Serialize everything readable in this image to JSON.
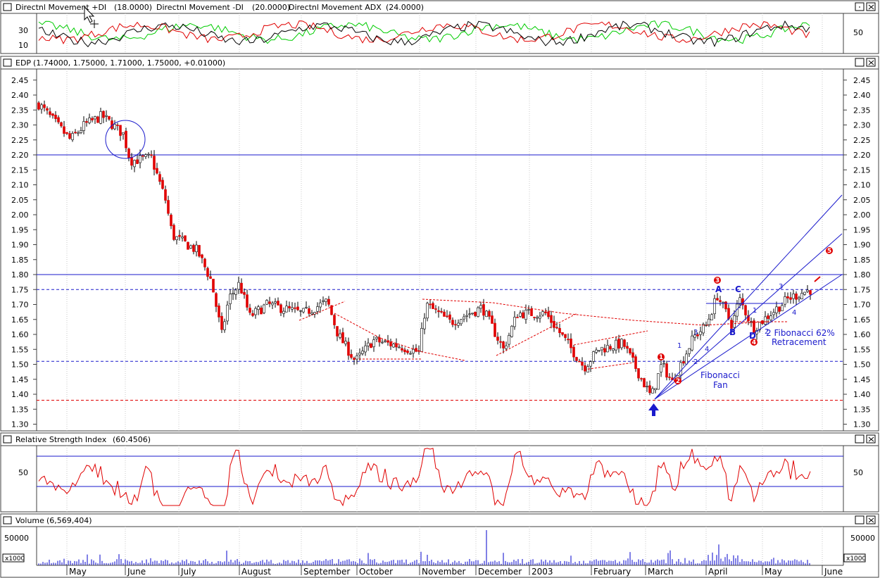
{
  "colors": {
    "background": "#ffffff",
    "frame": "#404040",
    "titlebar": "#ffffff",
    "grid": "#c8c8c8",
    "up_candle": "#ffffff",
    "down_candle": "#e00000",
    "positive_di": "#00cc00",
    "negative_di": "#e00000",
    "adx": "#000000",
    "rsi": "#e00000",
    "volume": "#0000cc",
    "annotation_blue": "#1a1acc",
    "annotation_red": "#e00000"
  },
  "panes": {
    "dmi": {
      "title_prefix": "Directnl Movement +DI",
      "plus_di_value": "(18.0000)",
      "minus_di_label": "Directnl Movement -DI",
      "minus_di_value": "(20.0000)",
      "adx_label": "Directnl Movement ADX",
      "adx_value": "(24.0000)",
      "left_ticks": [
        "30",
        "10"
      ],
      "right_ticks": [
        "50"
      ]
    },
    "price": {
      "title_symbol": "EDP",
      "title_values": "(1.74000, 1.75000, 1.71000, 1.75000, +0.01000)",
      "ticks": [
        "2.45",
        "2.40",
        "2.35",
        "2.30",
        "2.25",
        "2.20",
        "2.15",
        "2.10",
        "2.05",
        "2.00",
        "1.95",
        "1.90",
        "1.85",
        "1.80",
        "1.75",
        "1.70",
        "1.65",
        "1.60",
        "1.55",
        "1.50",
        "1.45",
        "1.40",
        "1.35",
        "1.30"
      ]
    },
    "rsi": {
      "title": "Relative Strength Index",
      "value": "(60.4506)",
      "left_ticks": [
        "50"
      ],
      "right_ticks": [
        "50"
      ]
    },
    "volume": {
      "title": "Volume",
      "value": "(6,569,404)",
      "tick_50000": "50000",
      "multiplier": "x1000"
    }
  },
  "x_axis": {
    "months": [
      "May",
      "June",
      "July",
      "August",
      "September",
      "October",
      "November",
      "December",
      "2003",
      "February",
      "March",
      "April",
      "May",
      "June"
    ]
  },
  "annotations": {
    "fib_fan": "Fibonacci\nFan",
    "fib_retr": "2 Fibonacci 62%\nRetracement",
    "wave_a": "A",
    "wave_b": "B",
    "wave_c": "C",
    "wave_d": "D",
    "impulse_labels": [
      "1",
      "2",
      "3",
      "4",
      "5"
    ],
    "sub_labels": [
      "1",
      "2",
      "3",
      "4",
      "1",
      "2",
      "3",
      "4"
    ]
  },
  "chart_data": [
    {
      "type": "line",
      "title": "Directnl Movement +DI / -DI / ADX",
      "series": [
        {
          "name": "Directnl Movement +DI",
          "last": 18.0
        },
        {
          "name": "Directnl Movement -DI",
          "last": 20.0
        },
        {
          "name": "Directnl Movement ADX",
          "last": 24.0
        }
      ]
    },
    {
      "type": "candlestick",
      "title": "EDP",
      "ohlc_last": {
        "open": 1.74,
        "high": 1.75,
        "low": 1.71,
        "close": 1.75,
        "change": 0.01
      },
      "ylim": [
        1.3,
        2.45
      ],
      "horizontal_levels": [
        2.2,
        1.8,
        1.75,
        1.51,
        1.38
      ],
      "approx_closes_by_month": [
        {
          "month": "May",
          "close": 2.3
        },
        {
          "month": "June",
          "close": 2.18
        },
        {
          "month": "July",
          "close": 1.88
        },
        {
          "month": "August",
          "close": 1.72
        },
        {
          "month": "September",
          "close": 1.65
        },
        {
          "month": "October",
          "close": 1.55
        },
        {
          "month": "November",
          "close": 1.63
        },
        {
          "month": "December",
          "close": 1.58
        },
        {
          "month": "2003",
          "close": 1.64
        },
        {
          "month": "February",
          "close": 1.52
        },
        {
          "month": "March",
          "close": 1.45
        },
        {
          "month": "April",
          "close": 1.7
        },
        {
          "month": "May",
          "close": 1.73
        }
      ]
    },
    {
      "type": "line",
      "title": "Relative Strength Index",
      "series": [
        {
          "name": "Relative Strength Index",
          "last": 60.4506
        }
      ]
    },
    {
      "type": "bar",
      "title": "Volume",
      "series": [
        {
          "name": "Volume",
          "last": 6569404
        }
      ]
    }
  ]
}
